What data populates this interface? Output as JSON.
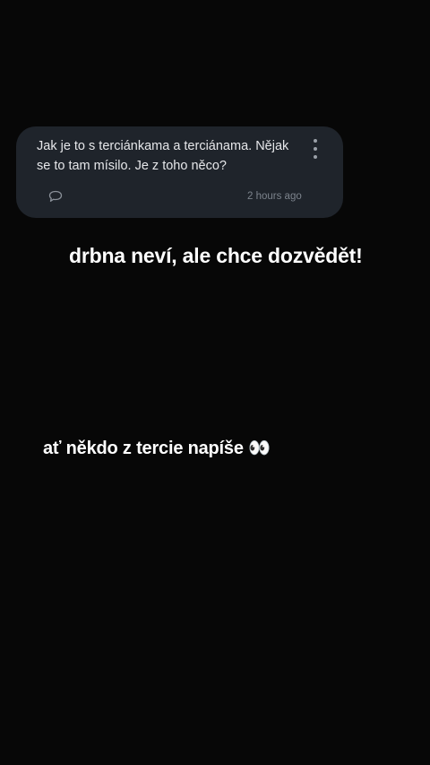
{
  "question_card": {
    "text": "Jak je to s terciánkama a terciánama. Nějak se to tam mísilo. Je z toho něco?",
    "timestamp": "2 hours ago",
    "icons": {
      "comment": "comment-icon",
      "menu": "more-vertical-icon"
    },
    "colors": {
      "background": "#1f242b",
      "text": "#e6e7ea",
      "muted": "#7c838c"
    }
  },
  "captions": {
    "line1": "drbna neví, ale chce dozvědět!",
    "line2": "ať někdo z tercie napíše 👀"
  },
  "page_background": "#070707"
}
